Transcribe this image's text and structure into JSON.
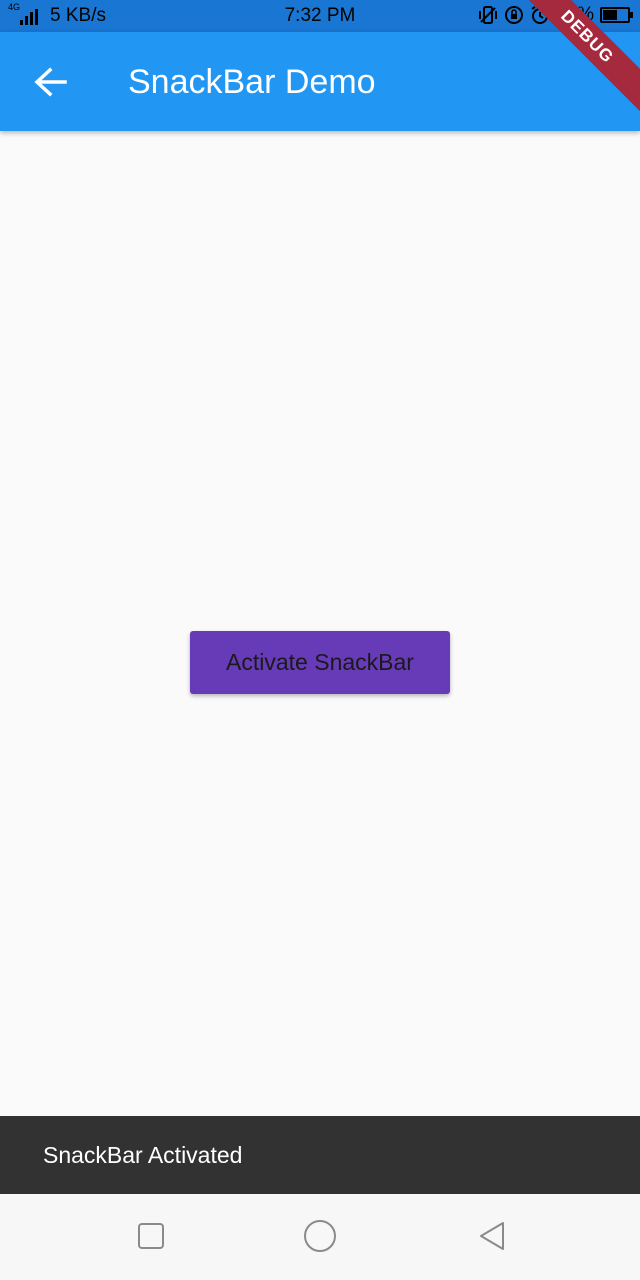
{
  "status_bar": {
    "network_type": "4G",
    "speed": "5 KB/s",
    "time": "7:32 PM",
    "battery": "58%",
    "battery_level": 0.58,
    "background_color": "#1976d2"
  },
  "app_bar": {
    "title": "SnackBar Demo",
    "back_icon": "arrow-back-icon",
    "debug_label": "DEBUG",
    "background_color": "#2196f3"
  },
  "main": {
    "button_label": "Activate SnackBar",
    "button_color": "#673ab7"
  },
  "snackbar": {
    "message": "SnackBar Activated",
    "background_color": "#323232"
  },
  "nav_bar": {
    "icons": [
      "recents-icon",
      "home-icon",
      "back-icon"
    ]
  }
}
